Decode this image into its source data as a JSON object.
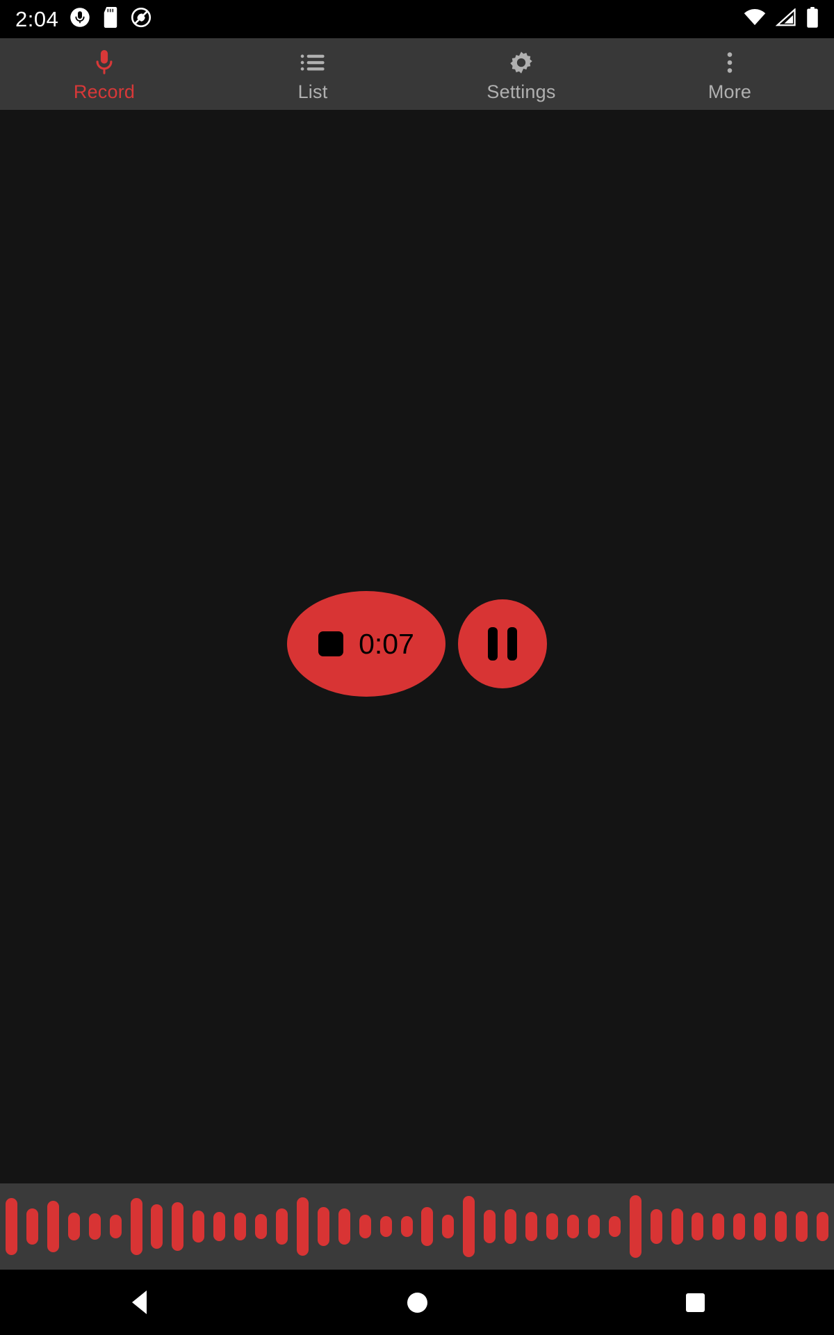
{
  "status_bar": {
    "time": "2:04",
    "left_icons": [
      "microphone-circle-icon",
      "sd-card-icon",
      "do-not-disturb-icon"
    ],
    "right_icons": [
      "wifi-icon",
      "cellular-signal-icon",
      "battery-icon"
    ],
    "background": "#000000",
    "foreground": "#ffffff"
  },
  "tab_bar": {
    "background": "#383838",
    "active_color": "#d83838",
    "inactive_color": "#b0b0b0",
    "tabs": [
      {
        "label": "Record",
        "icon": "microphone-icon",
        "active": true
      },
      {
        "label": "List",
        "icon": "list-icon",
        "active": false
      },
      {
        "label": "Settings",
        "icon": "gear-icon",
        "active": false
      },
      {
        "label": "More",
        "icon": "more-vertical-icon",
        "active": false
      }
    ]
  },
  "recorder": {
    "background": "#141414",
    "accent_color": "#d83434",
    "icon_color": "#000000",
    "stop_button": {
      "name": "stop-recording-button",
      "icon": "stop-square-icon",
      "elapsed_time": "0:07"
    },
    "pause_button": {
      "name": "pause-recording-button",
      "icon": "pause-icon"
    },
    "state": "recording"
  },
  "waveform": {
    "background": "#3a3a3a",
    "bar_color": "#d83434",
    "amplitudes": [
      82,
      52,
      74,
      40,
      38,
      34,
      82,
      64,
      70,
      46,
      42,
      40,
      36,
      52,
      84,
      56,
      52,
      34,
      30,
      30,
      56,
      34,
      88,
      48,
      50,
      42,
      38,
      34,
      34,
      30,
      90,
      50,
      52,
      40,
      38,
      38,
      40,
      44,
      44,
      42
    ]
  },
  "nav_bar": {
    "background": "#000000",
    "buttons": [
      {
        "name": "nav-back-button",
        "icon": "back-triangle-icon"
      },
      {
        "name": "nav-home-button",
        "icon": "home-circle-icon"
      },
      {
        "name": "nav-recents-button",
        "icon": "recents-square-icon"
      }
    ]
  }
}
